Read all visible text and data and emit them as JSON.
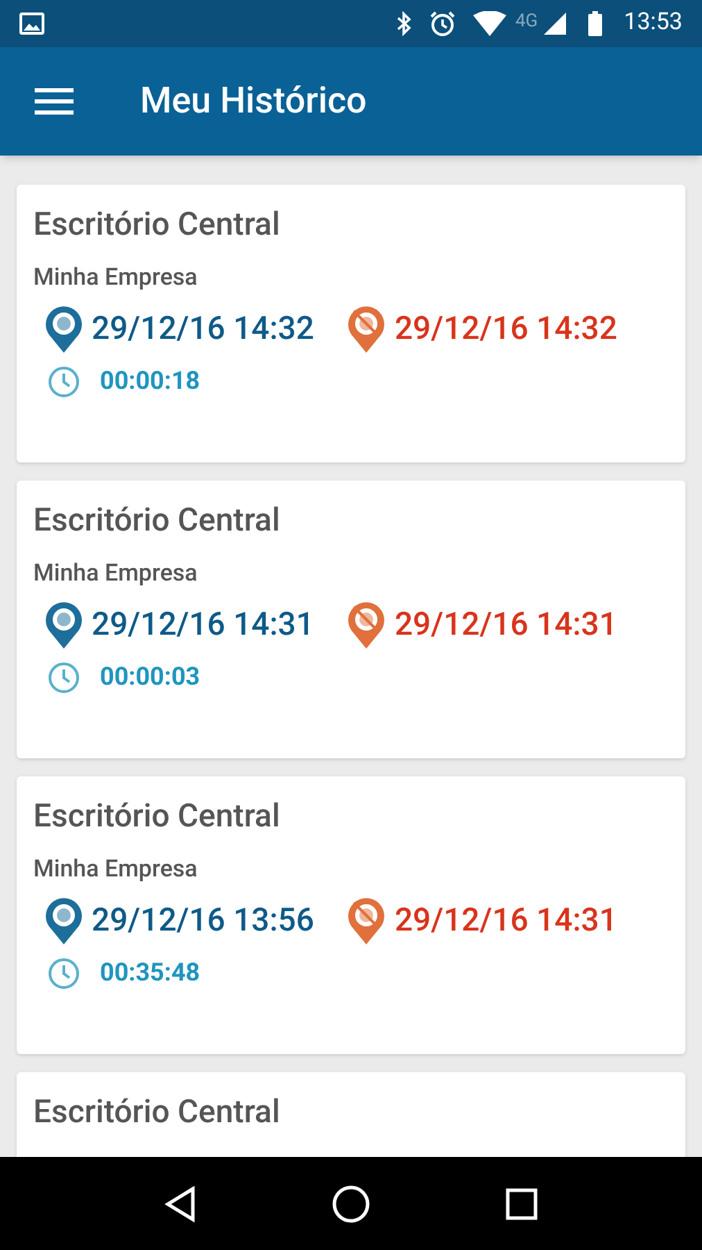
{
  "status_bar": {
    "network": "4G",
    "time": "13:53"
  },
  "app_bar": {
    "title": "Meu Histórico"
  },
  "entries": [
    {
      "place": "Escritório Central",
      "company": "Minha Empresa",
      "check_in": "29/12/16 14:32",
      "check_out": "29/12/16 14:32",
      "duration": "00:00:18"
    },
    {
      "place": "Escritório Central",
      "company": "Minha Empresa",
      "check_in": "29/12/16 14:31",
      "check_out": "29/12/16 14:31",
      "duration": "00:00:03"
    },
    {
      "place": "Escritório Central",
      "company": "Minha Empresa",
      "check_in": "29/12/16 13:56",
      "check_out": "29/12/16 14:31",
      "duration": "00:35:48"
    },
    {
      "place": "Escritório Central"
    }
  ]
}
